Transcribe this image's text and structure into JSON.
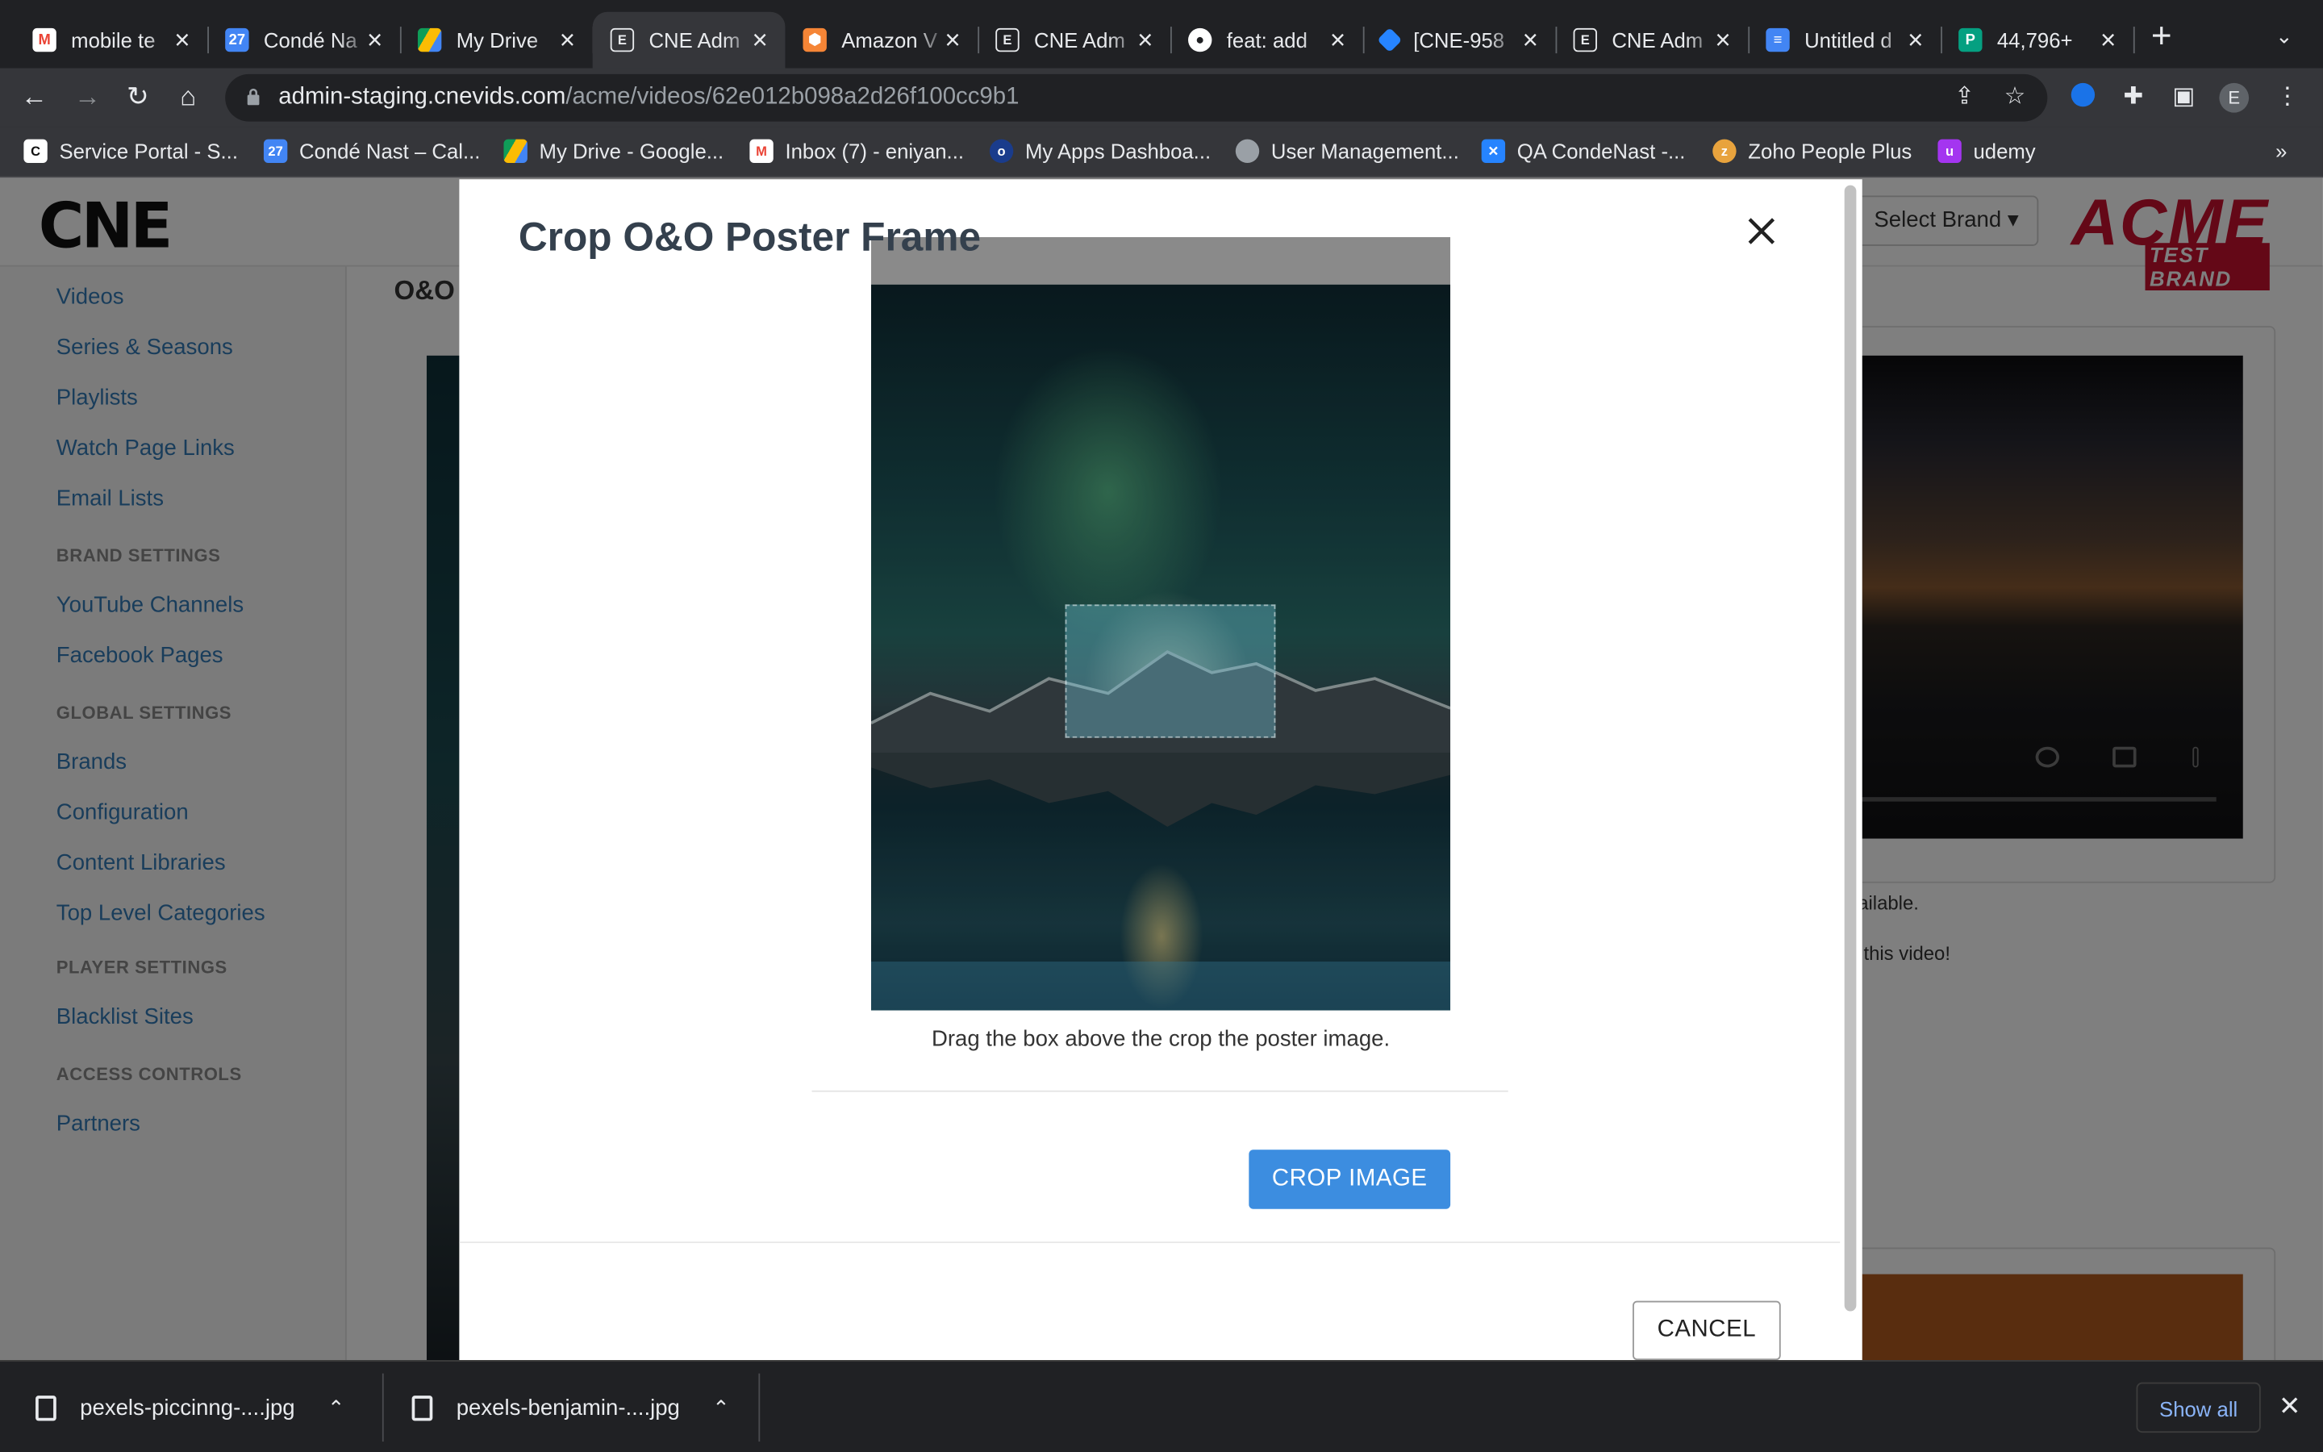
{
  "tabs": [
    {
      "title": "mobile te",
      "icon": "gmail-icon",
      "color": "#ea4335"
    },
    {
      "title": "Condé Na",
      "icon": "calendar-icon",
      "color": "#4285f4"
    },
    {
      "title": "My Drive",
      "icon": "drive-icon",
      "color": "#fbbc04"
    },
    {
      "title": "CNE Adm",
      "icon": "cne-icon",
      "color": "#5f6368"
    },
    {
      "title": "Amazon V",
      "icon": "aws-icon",
      "color": "#f58536"
    },
    {
      "title": "CNE Adm",
      "icon": "cne-icon",
      "color": "#5f6368"
    },
    {
      "title": "feat: add",
      "icon": "github-icon",
      "color": "#ffffff"
    },
    {
      "title": "[CNE-958",
      "icon": "jira-icon",
      "color": "#2684ff"
    },
    {
      "title": "CNE Adm",
      "icon": "cne-icon",
      "color": "#5f6368"
    },
    {
      "title": "Untitled d",
      "icon": "docs-icon",
      "color": "#4285f4"
    },
    {
      "title": "44,796+",
      "icon": "pexels-icon",
      "color": "#05a081"
    }
  ],
  "url": {
    "host": "admin-staging.cnevids.com",
    "path": "/acme/videos/62e012b098a2d26f100cc9b1"
  },
  "profile_initial": "E",
  "bookmarks": [
    {
      "label": "Service Portal - S...",
      "icon": "service-portal-icon",
      "color": "#111111"
    },
    {
      "label": "Condé Nast – Cal...",
      "icon": "calendar-icon",
      "color": "#4285f4"
    },
    {
      "label": "My Drive - Google...",
      "icon": "drive-icon",
      "color": "#fbbc04"
    },
    {
      "label": "Inbox (7) - eniyan...",
      "icon": "gmail-icon",
      "color": "#ea4335"
    },
    {
      "label": "My Apps Dashboa...",
      "icon": "okta-icon",
      "color": "#1a3c8c"
    },
    {
      "label": "User Management...",
      "icon": "globe-icon",
      "color": "#9aa0a6"
    },
    {
      "label": "QA CondeNast -...",
      "icon": "confluence-icon",
      "color": "#2684ff"
    },
    {
      "label": "Zoho People Plus",
      "icon": "zoho-icon",
      "color": "#e8a33d"
    },
    {
      "label": "udemy",
      "icon": "udemy-icon",
      "color": "#a435f0"
    }
  ],
  "page": {
    "logo": "CNE",
    "brand_select": "Select Brand ▾",
    "acme": "ACME",
    "acme_sub": "TEST BRAND",
    "section_title": "O&O",
    "sidebar": {
      "videos": "Videos",
      "series": "Series & Seasons",
      "playlists": "Playlists",
      "watch": "Watch Page Links",
      "email": "Email Lists",
      "brand_head": "BRAND SETTINGS",
      "youtube": "YouTube Channels",
      "facebook": "Facebook Pages",
      "global_head": "GLOBAL SETTINGS",
      "brands": "Brands",
      "config": "Configuration",
      "content": "Content Libraries",
      "toplevel": "Top Level Categories",
      "player_head": "PLAYER SETTINGS",
      "blacklist": "Blacklist Sites",
      "access_head": "ACCESS CONTROLS",
      "partners": "Partners"
    },
    "note1": "ailable.",
    "note2": "r this video!"
  },
  "modal": {
    "title": "Crop O&O Poster Frame",
    "hint": "Drag the box above the crop the poster image.",
    "crop_button": "CROP IMAGE",
    "cancel_button": "CANCEL"
  },
  "downloads": [
    {
      "filename": "pexels-piccinng-....jpg"
    },
    {
      "filename": "pexels-benjamin-....jpg"
    }
  ],
  "show_all": "Show all"
}
